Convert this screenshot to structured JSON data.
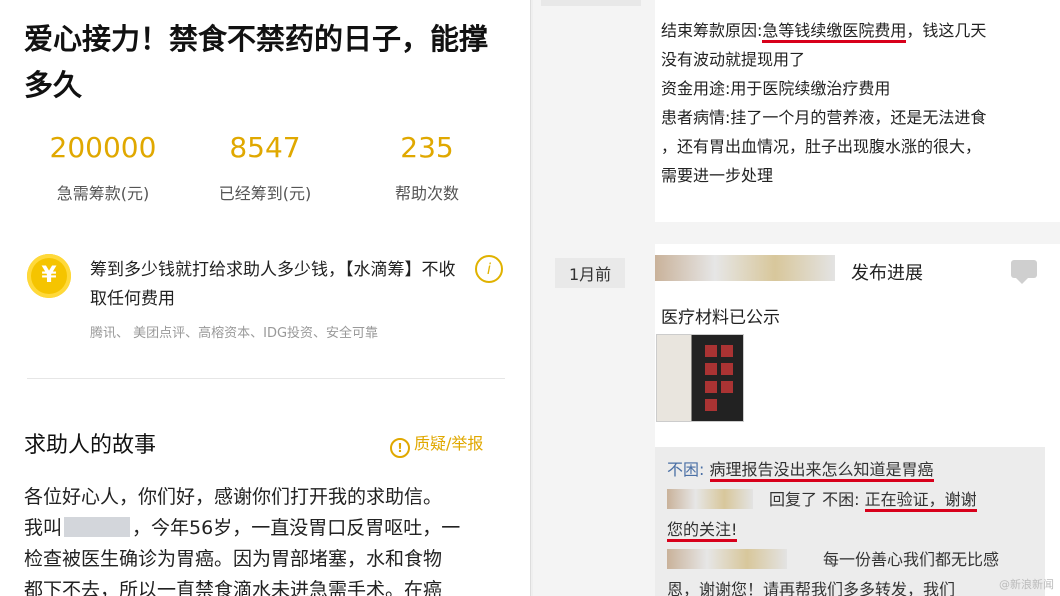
{
  "left": {
    "title": "爱心接力！禁食不禁药的日子，能撑多久",
    "stats": [
      {
        "value": "200000",
        "label": "急需筹款(元)"
      },
      {
        "value": "8547",
        "label": "已经筹到(元)"
      },
      {
        "value": "235",
        "label": "帮助次数"
      }
    ],
    "coin_symbol": "¥",
    "info_text": "筹到多少钱就打给求助人多少钱，【水滴筹】不收取任何费用",
    "partners": "腾讯、 美团点评、高榕资本、IDG投资、安全可靠",
    "info_icon": "i",
    "story_title": "求助人的故事",
    "report_icon": "!",
    "report_label": "质疑/举报",
    "story_l1": "各位好心人，你们好，感谢你们打开我的求助信。",
    "story_l2a": "我叫",
    "story_l2b": "，今年56岁，一直没胃口反胃呕吐，一",
    "story_l3": "检查被医生确诊为胃癌。因为胃部堵塞，水和食物",
    "story_l4": "都下不去，所以一直禁食滴水未进急需手术。在癌"
  },
  "right": {
    "reason_prefix": "结束筹款原因:",
    "reason_highlight": "急等钱续缴医院费用",
    "reason_suffix": "，钱这几天",
    "reason_l2": "没有波动就提现用了",
    "usage": "资金用途:用于医院续缴治疗费用",
    "condition_l1": "患者病情:挂了一个月的营养液，还是无法进食",
    "condition_l2": "，还有胃出血情况，肚子出现腹水涨的很大，",
    "condition_l3": "需要进一步处理",
    "time_ago": "1月前",
    "publish_label": "发布进展",
    "medical_title": "医疗材料已公示",
    "reply1_name": "不困:",
    "reply1_text": "病理报告没出来怎么知道是胃癌",
    "reply2_mid": "回复了 不困:",
    "reply2_text": "正在验证，谢谢",
    "reply2_text2": "您的关注!",
    "reply3_l1": "每一份善心我们都无比感",
    "reply3_l2": "恩，谢谢您！请再帮我们多多转发，",
    "reply3_l2b": "我们",
    "watermark": "@新浪新闻"
  },
  "colors": {
    "accent": "#e0a800",
    "underline": "#d8001b"
  }
}
